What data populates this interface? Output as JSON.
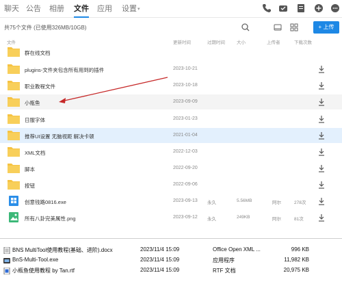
{
  "nav": {
    "tabs": [
      {
        "label": "聊天"
      },
      {
        "label": "公告"
      },
      {
        "label": "相册"
      },
      {
        "label": "文件"
      },
      {
        "label": "应用"
      },
      {
        "label": "设置"
      }
    ],
    "active_tab": "文件"
  },
  "toolbar": {
    "summary": "共75个文件 (已使用326MB/10GB)",
    "new_label": "+ 上传"
  },
  "columns": {
    "name": "文件",
    "updated": "更新时间",
    "expiry": "过期时间",
    "size": "大小",
    "uploader": "上传者",
    "downloads": "下载次数"
  },
  "rows": [
    {
      "name": "群在线文档",
      "type": "folder",
      "date": "",
      "expiry": "",
      "size": "",
      "uploader": "",
      "downloads": ""
    },
    {
      "name": "plugins-文件夹包含所有用到的插件",
      "type": "folder",
      "date": "2023-10-21",
      "expiry": "",
      "size": "",
      "uploader": "",
      "downloads": ""
    },
    {
      "name": "职业教程文件",
      "type": "folder",
      "date": "2023-10-18",
      "expiry": "",
      "size": "",
      "uploader": "",
      "downloads": ""
    },
    {
      "name": "小瓶鱼",
      "type": "folder",
      "date": "2023-09-09",
      "expiry": "",
      "size": "",
      "uploader": "",
      "downloads": ""
    },
    {
      "name": "日服字体",
      "type": "folder",
      "date": "2023-01-23",
      "expiry": "",
      "size": "",
      "uploader": "",
      "downloads": ""
    },
    {
      "name": "推荐UI设置 无脑视距 解决卡顿",
      "type": "folder",
      "date": "2021-01-04",
      "expiry": "",
      "size": "",
      "uploader": "",
      "downloads": ""
    },
    {
      "name": "XML文档",
      "type": "folder",
      "date": "2022-12-03",
      "expiry": "",
      "size": "",
      "uploader": "",
      "downloads": ""
    },
    {
      "name": "脚本",
      "type": "folder",
      "date": "2022-09-20",
      "expiry": "",
      "size": "",
      "uploader": "",
      "downloads": ""
    },
    {
      "name": "按钮",
      "type": "folder",
      "date": "2022-09-06",
      "expiry": "",
      "size": "",
      "uploader": "",
      "downloads": ""
    },
    {
      "name": "创意钱路0816.exe",
      "type": "exe",
      "date": "2023-09-13",
      "expiry": "永久",
      "size": "5.56MB",
      "uploader": "阿尔",
      "downloads": "278次"
    },
    {
      "name": "所有八卦完美属性.png",
      "type": "png",
      "date": "2023-09-12",
      "expiry": "永久",
      "size": "249KB",
      "uploader": "阿尔",
      "downloads": "81次"
    }
  ],
  "explorer": [
    {
      "name": "BNS MultiTool使用教程(基础、进阶).docx",
      "date": "2023/11/4 15:09",
      "type": "Office Open XML ...",
      "size": "996 KB"
    },
    {
      "name": "BnS-Multi-Tool.exe",
      "date": "2023/11/4 15:09",
      "type": "应用程序",
      "size": "11,982 KB"
    },
    {
      "name": "小瓶鱼使用教程 by Tan.rtf",
      "date": "2023/11/4 15:09",
      "type": "RTF 文档",
      "size": "20,975 KB"
    }
  ],
  "colors": {
    "accent": "#1e88e5",
    "folder": "#f6c342",
    "arrow": "#c62828"
  }
}
